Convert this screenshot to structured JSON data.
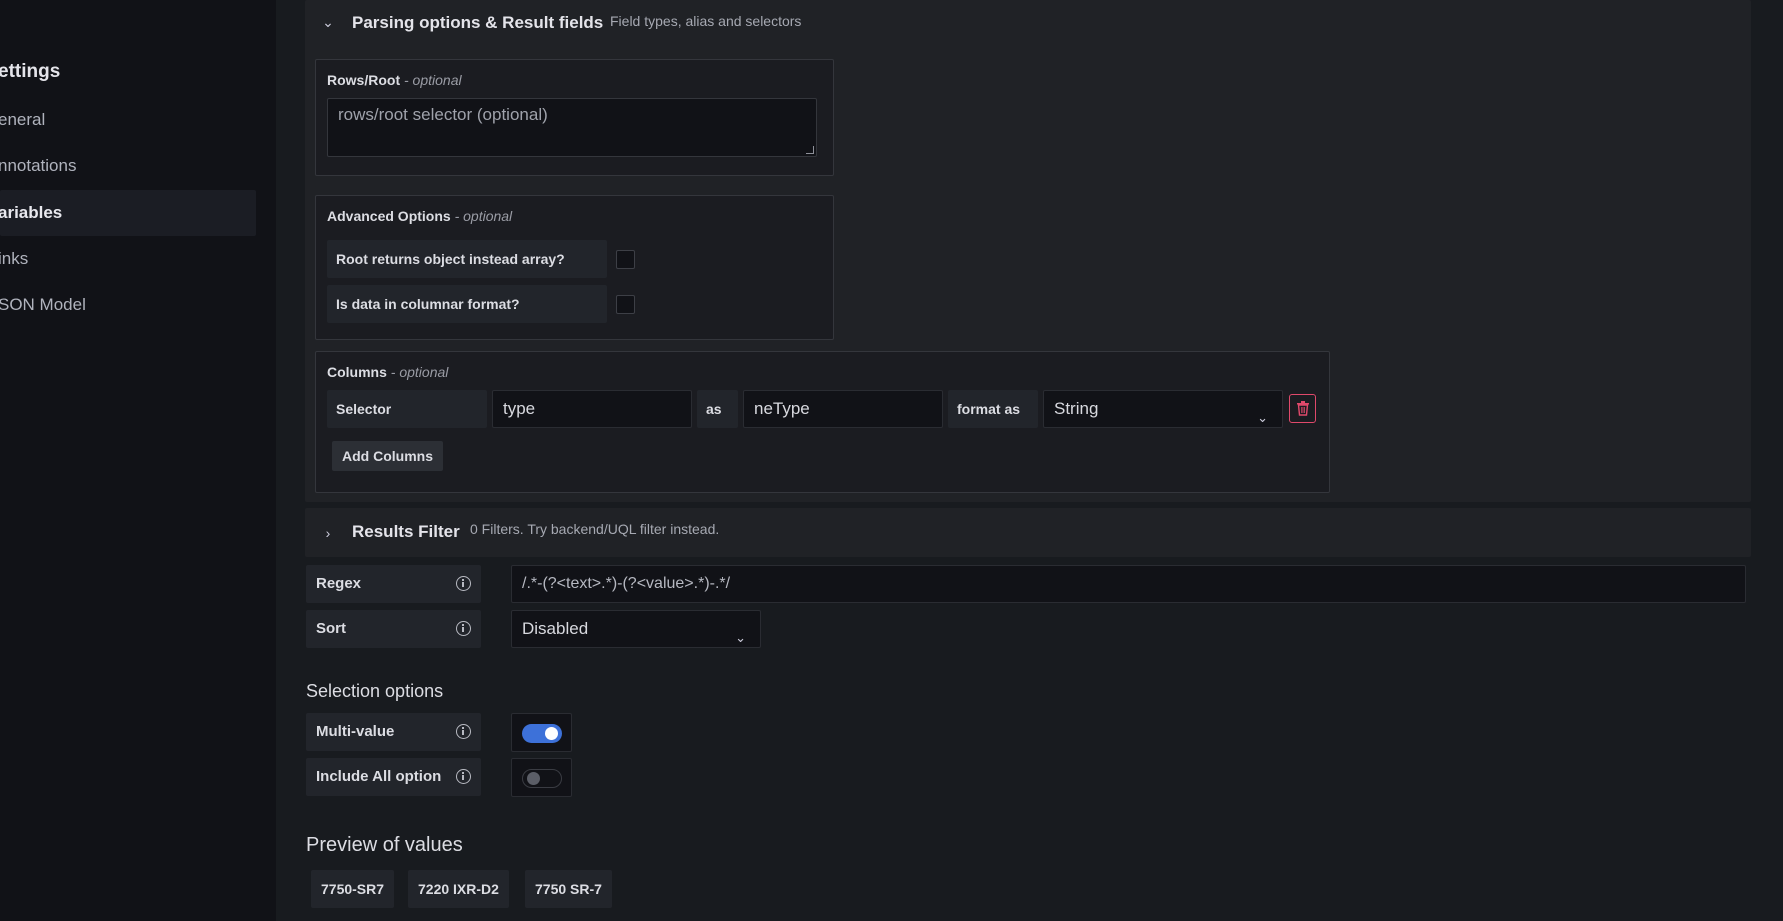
{
  "sidebar": {
    "title": "ettings",
    "items": [
      {
        "label": "eneral"
      },
      {
        "label": "nnotations"
      },
      {
        "label": "ariables"
      },
      {
        "label": "inks"
      },
      {
        "label": "SON Model"
      }
    ]
  },
  "parsing": {
    "title": "Parsing options & Result fields",
    "description": "Field types, alias and selectors",
    "rows_root": {
      "label": "Rows/Root",
      "optional": "- optional",
      "placeholder": "rows/root selector (optional)"
    },
    "advanced": {
      "label": "Advanced Options",
      "optional": "- optional",
      "root_object_label": "Root returns object instead array?",
      "columnar_label": "Is data in columnar format?"
    },
    "columns": {
      "label": "Columns",
      "optional": "- optional",
      "selector_label": "Selector",
      "selector_value": "type",
      "as_label": "as",
      "alias_value": "neType",
      "format_label": "format as",
      "format_value": "String",
      "add_button": "Add Columns"
    }
  },
  "results_filter": {
    "title": "Results Filter",
    "description": "0 Filters. Try backend/UQL filter instead."
  },
  "regex": {
    "label": "Regex",
    "value": "/.*-(?<text>.*)-(?<value>.*)-.*/"
  },
  "sort": {
    "label": "Sort",
    "value": "Disabled"
  },
  "selection_options": {
    "title": "Selection options",
    "multi_value_label": "Multi-value",
    "multi_value": true,
    "include_all_label": "Include All option",
    "include_all": false
  },
  "preview": {
    "title": "Preview of values",
    "values": [
      "7750-SR7",
      "7220 IXR-D2",
      "7750 SR-7"
    ]
  },
  "colors": {
    "accent_blue": "#3d71d9",
    "danger_red": "#e0496b"
  }
}
